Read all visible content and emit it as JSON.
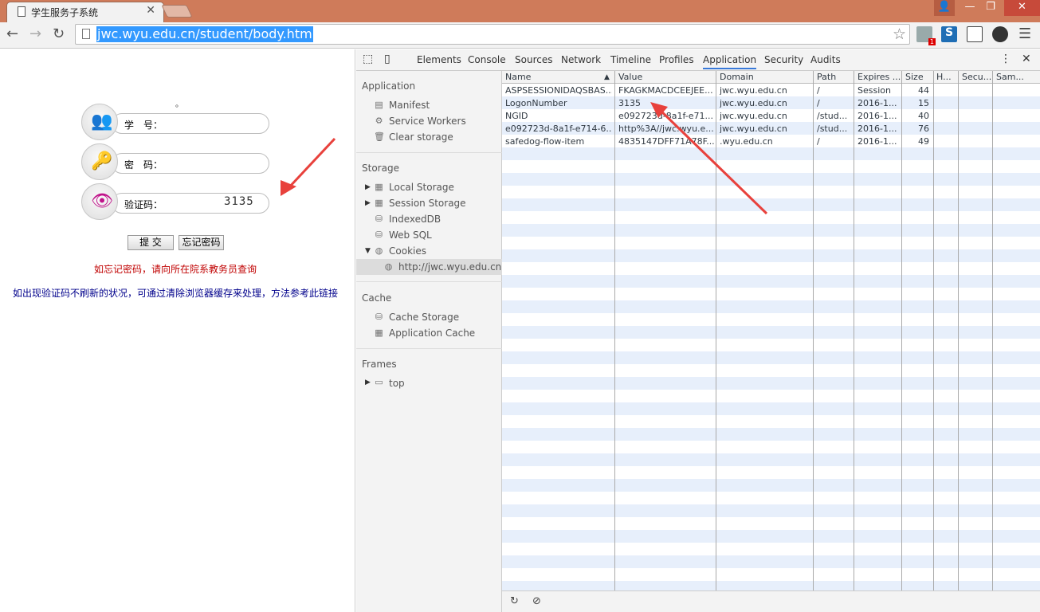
{
  "browser": {
    "tab_title": "学生服务子系统",
    "url": "jwc.wyu.edu.cn/student/body.htm"
  },
  "login": {
    "dot": "。",
    "student_id_label": "学　号：",
    "password_label": "密　码：",
    "captcha_label": "验证码：",
    "captcha_value": "3135",
    "submit_button": "提 交",
    "forgot_button": "忘记密码",
    "forgot_notice": "如忘记密码，请向所在院系教务员查询",
    "cache_notice": "如出现验证码不刷新的状况，可通过清除浏览器缓存来处理，方法参考此链接"
  },
  "devtools": {
    "tabs": [
      "Elements",
      "Console",
      "Sources",
      "Network",
      "Timeline",
      "Profiles",
      "Application",
      "Security",
      "Audits"
    ],
    "active_tab": "Application",
    "sidebar": {
      "application_section": "Application",
      "manifest": "Manifest",
      "service_workers": "Service Workers",
      "clear_storage": "Clear storage",
      "storage_section": "Storage",
      "local_storage": "Local Storage",
      "session_storage": "Session Storage",
      "indexeddb": "IndexedDB",
      "web_sql": "Web SQL",
      "cookies": "Cookies",
      "cookie_origin": "http://jwc.wyu.edu.cn",
      "cache_section": "Cache",
      "cache_storage": "Cache Storage",
      "application_cache": "Application Cache",
      "frames_section": "Frames",
      "top_frame": "top"
    },
    "columns": [
      "Name",
      "Value",
      "Domain",
      "Path",
      "Expires ...",
      "Size",
      "H...",
      "Secu...",
      "Sam..."
    ],
    "rows": [
      [
        "ASPSESSIONIDAQSBAS...",
        "FKAGKMACDCEEJEE...",
        "jwc.wyu.edu.cn",
        "/",
        "Session",
        "44"
      ],
      [
        "LogonNumber",
        "3135",
        "jwc.wyu.edu.cn",
        "/",
        "2016-1...",
        "15"
      ],
      [
        "NGID",
        "e092723d-8a1f-e71...",
        "jwc.wyu.edu.cn",
        "/stud...",
        "2016-1...",
        "40"
      ],
      [
        "e092723d-8a1f-e714-6...",
        "http%3A//jwc.wyu.e...",
        "jwc.wyu.edu.cn",
        "/stud...",
        "2016-1...",
        "76"
      ],
      [
        "safedog-flow-item",
        "4835147DFF71A78F...",
        ".wyu.edu.cn",
        "/",
        "2016-1...",
        "49"
      ]
    ],
    "accent_color": "#3879d9"
  },
  "annotation_color": "#e8413c"
}
